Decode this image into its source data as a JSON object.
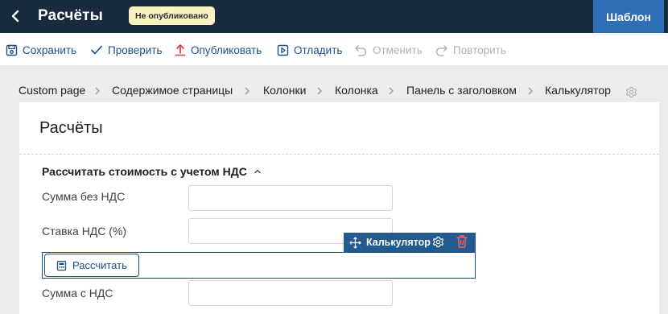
{
  "header": {
    "title": "Расчёты",
    "status_badge": "Не опубликовано",
    "template_button": "Шаблон"
  },
  "toolbar": {
    "save": "Сохранить",
    "check": "Проверить",
    "publish": "Опубликовать",
    "debug": "Отладить",
    "undo": "Отменить",
    "redo": "Повторить"
  },
  "breadcrumbs": [
    "Custom page",
    "Содержимое страницы",
    "Колонки",
    "Колонка",
    "Панель с заголовком",
    "Калькулятор"
  ],
  "page": {
    "title": "Расчёты",
    "section_title": "Рассчитать стоимость с учетом НДС",
    "fields": [
      {
        "label": "Сумма без НДС",
        "value": ""
      },
      {
        "label": "Ставка НДС (%)",
        "value": ""
      },
      {
        "label": "Сумма с НДС",
        "value": ""
      }
    ],
    "calculate_button": "Рассчитать"
  },
  "selected_widget": {
    "label": "Калькулятор"
  },
  "colors": {
    "topbar": "#172a3e",
    "accent": "#2f6eb5",
    "link": "#1c4f86",
    "badge": "#fbf2c4",
    "delete": "#e0353b"
  },
  "icons": {
    "back": "chevron-left-icon",
    "save": "save-icon",
    "check": "checkmark-icon",
    "publish": "upload-arrow-icon",
    "debug": "debug-play-icon",
    "undo": "undo-icon",
    "redo": "redo-icon",
    "crumb_settings": "gear-icon",
    "section_toggle": "chevron-up-icon",
    "calculator": "calculator-icon",
    "move": "move-arrows-icon",
    "widget_settings": "gear-icon",
    "delete": "trash-icon"
  }
}
